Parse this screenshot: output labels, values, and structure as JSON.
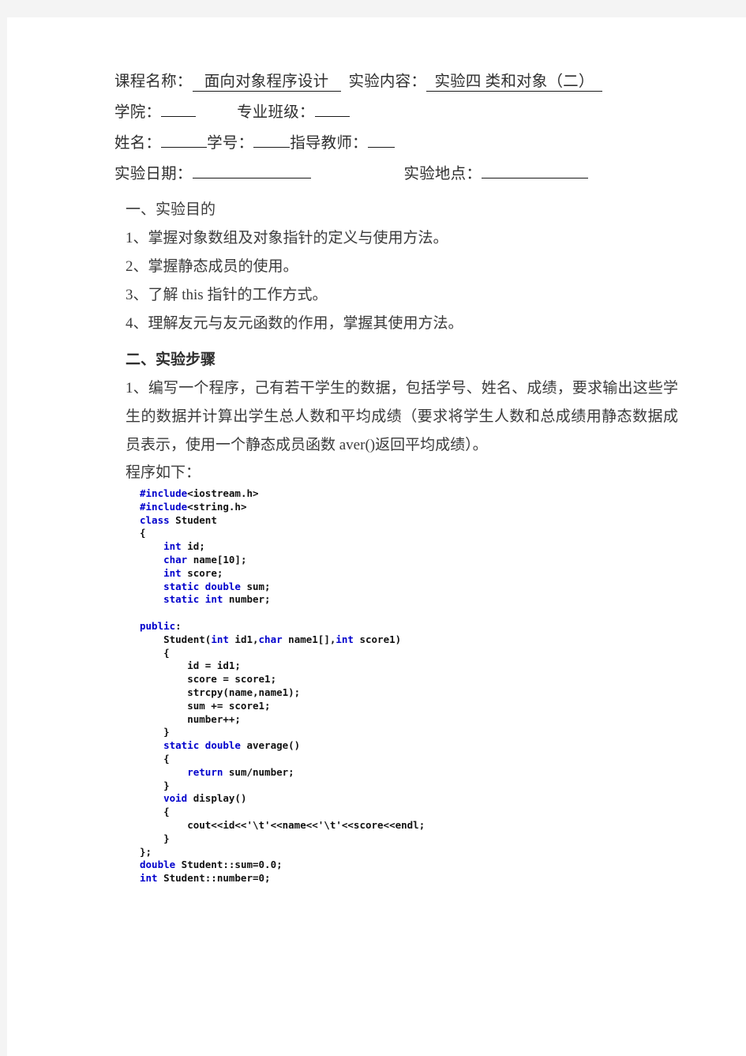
{
  "document": {
    "header": {
      "line1": {
        "label_course": "课程名称：",
        "value_course": "面向对象程序设计",
        "label_content": "实验内容：",
        "value_content": "实验四  类和对象（二）"
      },
      "line2": {
        "label_college": "学院：",
        "value_college": "",
        "label_class": "专业班级：",
        "value_class": ""
      },
      "line3": {
        "label_name": "姓名：",
        "value_name": "",
        "label_id": "学号：",
        "value_id": "",
        "label_teacher": "指导教师：",
        "value_teacher": ""
      },
      "line4": {
        "label_date": "实验日期：",
        "value_date": "",
        "label_place": "实验地点：",
        "value_place": ""
      }
    },
    "section_objectives": {
      "title": "一、实验目的",
      "items": [
        "1、掌握对象数组及对象指针的定义与使用方法。",
        "2、掌握静态成员的使用。",
        "3、了解 this 指针的工作方式。",
        "4、理解友元与友元函数的作用，掌握其使用方法。"
      ]
    },
    "section_steps": {
      "title": "二、实验步骤",
      "paragraph": "1、编写一个程序，己有若干学生的数据，包括学号、姓名、成绩，要求输出这些学生的数据并计算出学生总人数和平均成绩（要求将学生人数和总成绩用静态数据成员表示，使用一个静态成员函数 aver()返回平均成绩）。",
      "program_label": "程序如下："
    },
    "code": {
      "language": "cpp",
      "keyword_color": "#0000cc",
      "text_color": "#111111",
      "lines": [
        [
          {
            "t": "#include",
            "k": true
          },
          {
            "t": "<iostream.h>",
            "k": false
          }
        ],
        [
          {
            "t": "#include",
            "k": true
          },
          {
            "t": "<string.h>",
            "k": false
          }
        ],
        [
          {
            "t": "class",
            "k": true
          },
          {
            "t": " Student",
            "k": false
          }
        ],
        [
          {
            "t": "{",
            "k": false
          }
        ],
        [
          {
            "t": "    ",
            "k": false
          },
          {
            "t": "int",
            "k": true
          },
          {
            "t": " id;",
            "k": false
          }
        ],
        [
          {
            "t": "    ",
            "k": false
          },
          {
            "t": "char",
            "k": true
          },
          {
            "t": " name[10];",
            "k": false
          }
        ],
        [
          {
            "t": "    ",
            "k": false
          },
          {
            "t": "int",
            "k": true
          },
          {
            "t": " score;",
            "k": false
          }
        ],
        [
          {
            "t": "    ",
            "k": false
          },
          {
            "t": "static double",
            "k": true
          },
          {
            "t": " sum;",
            "k": false
          }
        ],
        [
          {
            "t": "    ",
            "k": false
          },
          {
            "t": "static int",
            "k": true
          },
          {
            "t": " number;",
            "k": false
          }
        ],
        [],
        [
          {
            "t": "public",
            "k": true
          },
          {
            "t": ":",
            "k": false
          }
        ],
        [
          {
            "t": "    Student(",
            "k": false
          },
          {
            "t": "int",
            "k": true
          },
          {
            "t": " id1,",
            "k": false
          },
          {
            "t": "char",
            "k": true
          },
          {
            "t": " name1[],",
            "k": false
          },
          {
            "t": "int",
            "k": true
          },
          {
            "t": " score1)",
            "k": false
          }
        ],
        [
          {
            "t": "    {",
            "k": false
          }
        ],
        [
          {
            "t": "        id = id1;",
            "k": false
          }
        ],
        [
          {
            "t": "        score = score1;",
            "k": false
          }
        ],
        [
          {
            "t": "        strcpy(name,name1);",
            "k": false
          }
        ],
        [
          {
            "t": "        sum += score1;",
            "k": false
          }
        ],
        [
          {
            "t": "        number++;",
            "k": false
          }
        ],
        [
          {
            "t": "    }",
            "k": false
          }
        ],
        [
          {
            "t": "    ",
            "k": false
          },
          {
            "t": "static double",
            "k": true
          },
          {
            "t": " average()",
            "k": false
          }
        ],
        [
          {
            "t": "    {",
            "k": false
          }
        ],
        [
          {
            "t": "        ",
            "k": false
          },
          {
            "t": "return",
            "k": true
          },
          {
            "t": " sum/number;",
            "k": false
          }
        ],
        [
          {
            "t": "    }",
            "k": false
          }
        ],
        [
          {
            "t": "    ",
            "k": false
          },
          {
            "t": "void",
            "k": true
          },
          {
            "t": " display()",
            "k": false
          }
        ],
        [
          {
            "t": "    {",
            "k": false
          }
        ],
        [
          {
            "t": "        cout<<id<<'\\t'<<name<<'\\t'<<score<<endl;",
            "k": false
          }
        ],
        [
          {
            "t": "    }",
            "k": false
          }
        ],
        [
          {
            "t": "};",
            "k": false
          }
        ],
        [
          {
            "t": "double",
            "k": true
          },
          {
            "t": " Student::sum=0.0;",
            "k": false
          }
        ],
        [
          {
            "t": "int",
            "k": true
          },
          {
            "t": " Student::number=0;",
            "k": false
          }
        ]
      ]
    }
  }
}
